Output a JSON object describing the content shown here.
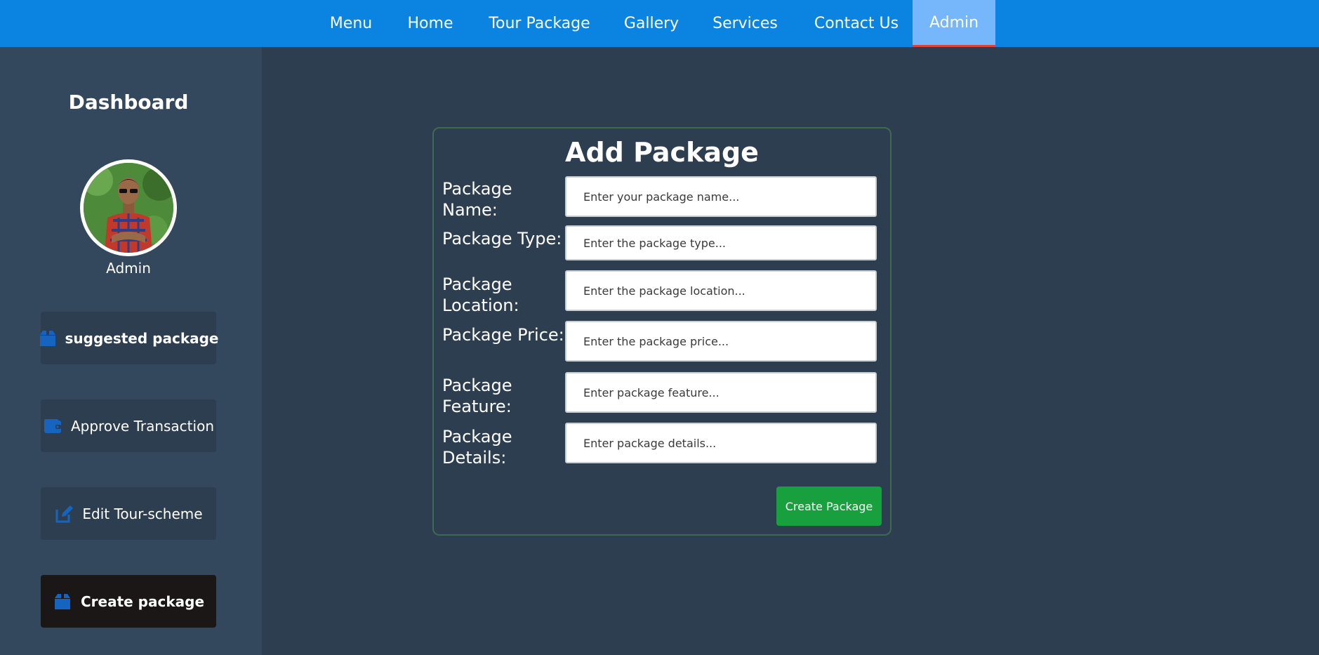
{
  "nav": {
    "items": [
      {
        "label": "Menu"
      },
      {
        "label": "Home"
      },
      {
        "label": "Tour Package"
      },
      {
        "label": "Gallery"
      },
      {
        "label": "Services"
      },
      {
        "label": "Contact Us"
      },
      {
        "label": "Admin",
        "active": true
      }
    ]
  },
  "sidebar": {
    "title": "Dashboard",
    "user_name": "Admin",
    "buttons": [
      {
        "label": "suggested package",
        "icon": "box-icon"
      },
      {
        "label": "Approve Transaction",
        "icon": "wallet-icon"
      },
      {
        "label": "Edit Tour-scheme",
        "icon": "edit-icon"
      },
      {
        "label": "Create package",
        "icon": "box-icon",
        "active": true
      }
    ]
  },
  "form": {
    "title": "Add Package",
    "fields": [
      {
        "label": "Package Name:",
        "placeholder": "Enter your package name..."
      },
      {
        "label": "Package Type:",
        "placeholder": "Enter the package type..."
      },
      {
        "label": "Package Location:",
        "placeholder": "Enter the package location..."
      },
      {
        "label": "Package Price:",
        "placeholder": "Enter the package price..."
      },
      {
        "label": "Package Feature:",
        "placeholder": "Enter package feature..."
      },
      {
        "label": "Package Details:",
        "placeholder": "Enter package details..."
      }
    ],
    "submit_label": "Create Package"
  },
  "colors": {
    "nav_bg": "#0b83e0",
    "nav_active_bg": "#76b6fa",
    "nav_active_underline": "#d9453b",
    "page_bg": "#2d3e51",
    "sidebar_bg": "#33475d",
    "icon_blue": "#1565c0",
    "submit_green": "#18a03f"
  }
}
